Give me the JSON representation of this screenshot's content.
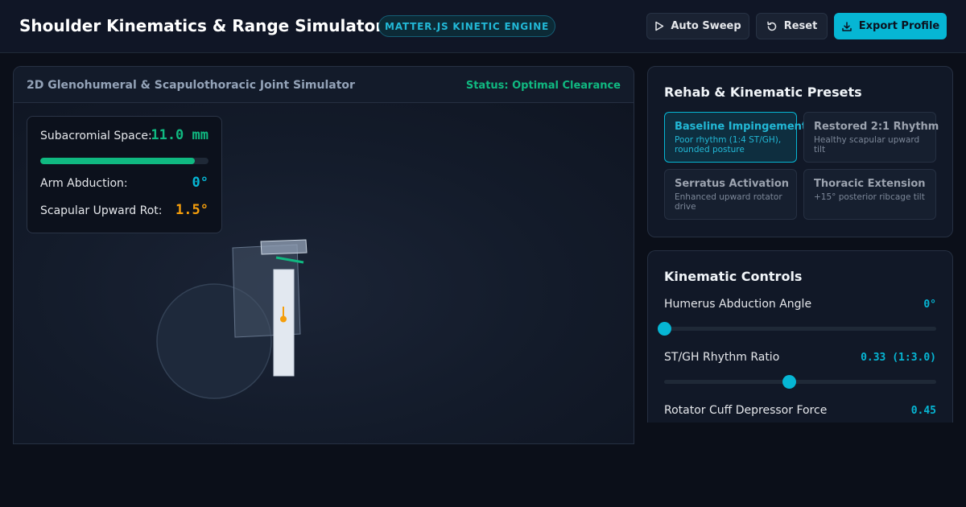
{
  "header": {
    "title": "Shoulder Kinematics & Range Simulator",
    "engine_badge": "MATTER.JS KINETIC ENGINE",
    "auto_sweep_label": "Auto Sweep",
    "reset_label": "Reset",
    "export_label": "Export Profile"
  },
  "simulator": {
    "title": "2D Glenohumeral & Scapulothoracic Joint Simulator",
    "status": "Status: Optimal Clearance",
    "readout": {
      "subacromial_label": "Subacromial Space:",
      "subacromial_value": "11.0 mm",
      "subacromial_fill": 0.92,
      "abduction_label": "Arm Abduction:",
      "abduction_value": "0°",
      "scapular_label": "Scapular Upward Rot:",
      "scapular_value": "1.5°"
    }
  },
  "presets": {
    "title": "Rehab & Kinematic Presets",
    "items": [
      {
        "name": "Baseline Impingement",
        "desc": "Poor rhythm (1:4 ST/GH), rounded posture",
        "active": true
      },
      {
        "name": "Restored 2:1 Rhythm",
        "desc": "Healthy scapular upward tilt",
        "active": false
      },
      {
        "name": "Serratus Activation",
        "desc": "Enhanced upward rotator drive",
        "active": false
      },
      {
        "name": "Thoracic Extension",
        "desc": "+15° posterior ribcage tilt",
        "active": false
      }
    ]
  },
  "controls": {
    "title": "Kinematic Controls",
    "sliders": [
      {
        "label": "Humerus Abduction Angle",
        "value": "0°",
        "fill": 0.0
      },
      {
        "label": "ST/GH Rhythm Ratio",
        "value": "0.33 (1:3.0)",
        "fill": 0.46
      },
      {
        "label": "Rotator Cuff Depressor Force",
        "value": "0.45"
      }
    ]
  },
  "colors": {
    "accent": "#06b6d4",
    "success": "#10b981",
    "warning": "#f59e0b",
    "background": "#0b0f19"
  },
  "icons": {
    "auto_sweep": "play-icon",
    "reset": "rotate-ccw-icon",
    "export": "download-icon"
  }
}
